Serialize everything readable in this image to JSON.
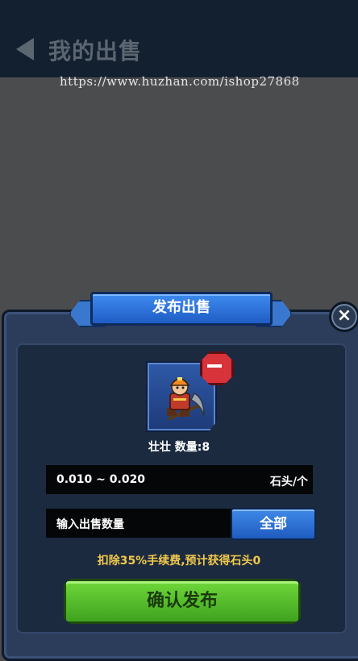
{
  "header": {
    "title": "我的出售",
    "watermark": "https://www.huzhan.com/ishop27868"
  },
  "dialog": {
    "title": "发布出售",
    "close_label": "×",
    "item": {
      "name_qty": "壮壮  数量:8",
      "icon": "miner-character-with-pickaxe"
    },
    "price": {
      "range": "0.010 ~ 0.020",
      "unit": "石头/个"
    },
    "quantity": {
      "placeholder": "输入出售数量",
      "all_label": "全部"
    },
    "fee_note": "扣除35%手续费,预计获得石头0",
    "confirm_label": "确认发布"
  },
  "colors": {
    "accent_blue": "#2f6fd8",
    "confirm_green": "#5bc02c",
    "warning_yellow": "#f1c94a",
    "remove_red": "#d8323a"
  }
}
